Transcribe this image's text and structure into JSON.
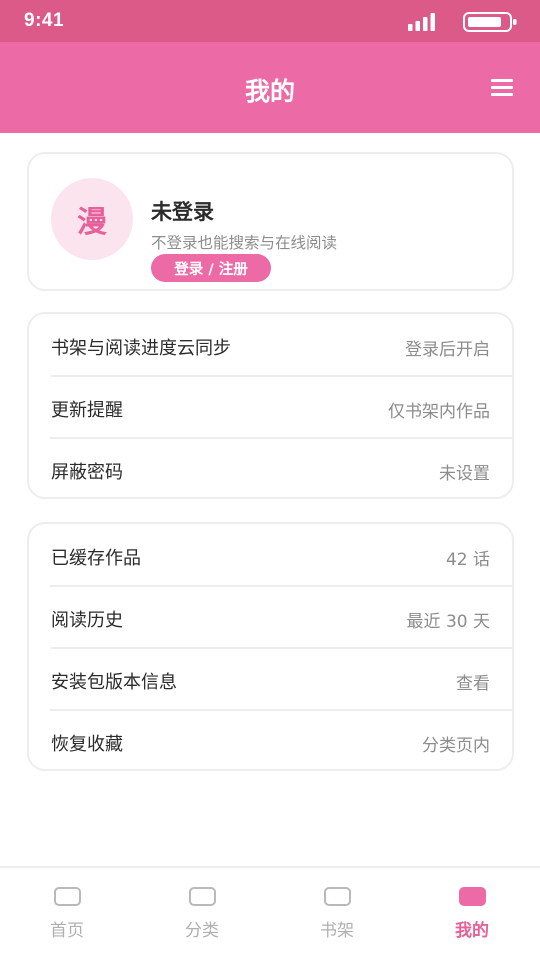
{
  "status_bar": {
    "time": "9:41",
    "icons": [
      "signal-icon",
      "battery-icon"
    ]
  },
  "header": {
    "title": "我的",
    "menu_icon": "menu-icon"
  },
  "profile": {
    "avatar_text": "漫",
    "name": "未登录",
    "description": "不登录也能搜索与在线阅读",
    "login_button": "登录 / 注册"
  },
  "settings_group": {
    "items": [
      {
        "label": "书架与阅读进度云同步",
        "value": "登录后开启"
      },
      {
        "label": "更新提醒",
        "value": "仅书架内作品"
      },
      {
        "label": "屏蔽密码",
        "value": "未设置"
      }
    ]
  },
  "library_group": {
    "items": [
      {
        "label": "已缓存作品",
        "value": "42 话"
      },
      {
        "label": "阅读历史",
        "value": "最近 30 天"
      },
      {
        "label": "安装包版本信息",
        "value": "查看"
      },
      {
        "label": "恢复收藏",
        "value": "分类页内"
      }
    ]
  },
  "tab_bar": {
    "tabs": [
      {
        "label": "首页",
        "icon": "home-icon"
      },
      {
        "label": "分类",
        "icon": "category-icon"
      },
      {
        "label": "书架",
        "icon": "bookshelf-icon"
      },
      {
        "label": "我的",
        "icon": "profile-icon"
      }
    ],
    "active_tab": "我的"
  },
  "colors": {
    "accent": "#ec6aa6",
    "status_bar": "#dc5a87",
    "avatar_bg": "#fbe4ee",
    "secondary_text": "#8c8c8c"
  }
}
